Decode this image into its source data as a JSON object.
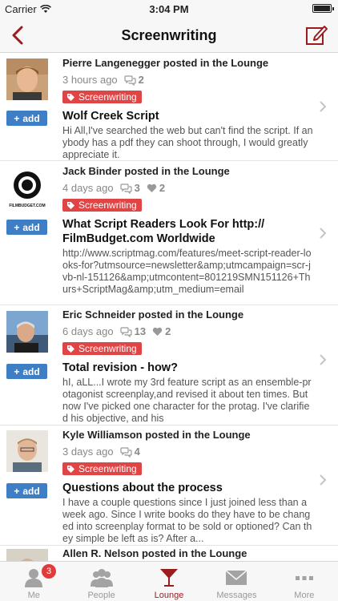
{
  "status_bar": {
    "carrier": "Carrier",
    "time": "3:04 PM"
  },
  "nav": {
    "title": "Screenwriting"
  },
  "posts": [
    {
      "author": "Pierre Langenegger posted in the Lounge",
      "time": "3 hours ago",
      "comments": "2",
      "likes": "",
      "tag": "Screenwriting",
      "title": "Wolf Creek Script",
      "excerpt": "Hi All,I've searched the web but can't find the script. If anybody has a pdf they can shoot through, I would greatly appreciate it.",
      "add_label": "add"
    },
    {
      "author": "Jack Binder posted in the Lounge",
      "time": "4 days ago",
      "comments": "3",
      "likes": "2",
      "tag": "Screenwriting",
      "title": "What Script Readers Look For  http:// FilmBudget.com Worldwide",
      "excerpt": "http://www.scriptmag.com/features/meet-script-reader-looks-for?utmsource=newsletter&amp;utmcampaign=scr-jvb-nl-151126&amp;utmcontent=801219SMN151126+Thurs+ScriptMag&amp;utm_medium=email",
      "add_label": "add",
      "avatar_text": "FILMBUDGET.COM"
    },
    {
      "author": "Eric Schneider posted in the Lounge",
      "time": "6 days ago",
      "comments": "13",
      "likes": "2",
      "tag": "Screenwriting",
      "title": "Total revision - how?",
      "excerpt": "hI, aLL...I wrote my 3rd feature script as an ensemble-protagonist screenplay,and revised it about ten times. But now I've picked one character for the protag. I've clarified his objective, and his",
      "add_label": "add"
    },
    {
      "author": "Kyle Williamson posted in the Lounge",
      "time": "3 days ago",
      "comments": "4",
      "likes": "",
      "tag": "Screenwriting",
      "title": "Questions about the process",
      "excerpt": "I have a couple questions since I just joined less than a week ago. Since I write books do they have to be changed into screenplay format to be sold or optioned? Can they simple be left as is? After a...",
      "add_label": "add"
    },
    {
      "author": "Allen R. Nelson posted in the Lounge"
    }
  ],
  "tabs": [
    {
      "label": "Me",
      "icon": "person-icon",
      "badge": "3"
    },
    {
      "label": "People",
      "icon": "people-icon"
    },
    {
      "label": "Lounge",
      "icon": "cocktail-icon"
    },
    {
      "label": "Messages",
      "icon": "envelope-icon"
    },
    {
      "label": "More",
      "icon": "more-dots-icon"
    }
  ],
  "colors": {
    "accent": "#9b1c1f",
    "tag": "#e04545",
    "add_button": "#3d7ec4",
    "badge": "#e03a3a"
  }
}
